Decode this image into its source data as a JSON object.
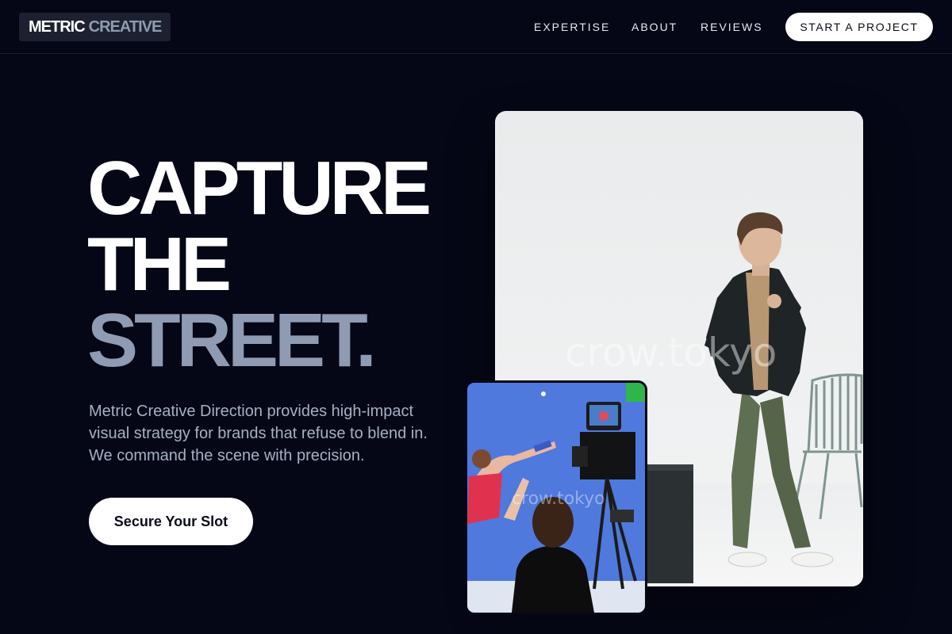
{
  "brand": {
    "word1": "METRIC",
    "word2": "CREATIVE"
  },
  "nav": {
    "links": [
      "EXPERTISE",
      "ABOUT",
      "REVIEWS"
    ],
    "cta": "START A PROJECT"
  },
  "hero": {
    "title_lines": [
      "CAPTURE",
      "THE",
      "STREET."
    ],
    "description_lines": [
      "Metric Creative Direction provides high-impact",
      "visual strategy for brands that refuse to blend in.",
      "We command the scene with precision."
    ],
    "cta": "Secure Your Slot"
  },
  "images": {
    "main_watermark": "crow.tokyo",
    "inset_watermark": "crow.tokyo"
  }
}
